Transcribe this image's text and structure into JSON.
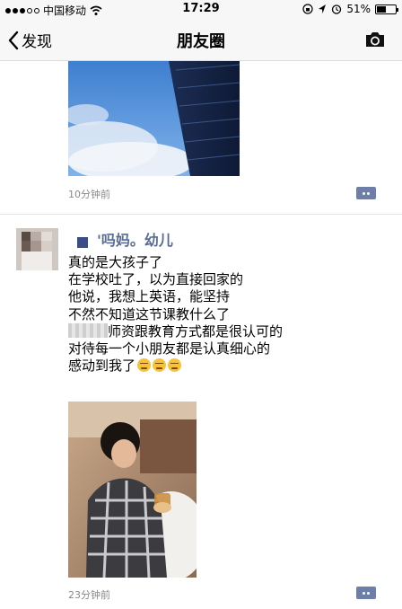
{
  "status_bar": {
    "carrier": "中国移动",
    "time": "17:29",
    "battery": "51%",
    "battery_level": 0.51
  },
  "nav": {
    "back_label": "发现",
    "title": "朋友圈"
  },
  "posts": [
    {
      "time_ago": "10分钟前"
    },
    {
      "author": "'吗妈。幼儿",
      "lines": [
        "真的是大孩子了",
        "在学校吐了，以为直接回家的",
        "他说，我想上英语，能坚持",
        "不然不知道这节课教什么了",
        "师资跟教育方式都是很认可的",
        "对待每一个小朋友都是认真细心的",
        "感动到我了"
      ],
      "time_ago": "23分钟前"
    }
  ],
  "icons": {
    "back": "chevron-left-icon",
    "camera": "camera-icon",
    "comment": "comment-icon",
    "wifi": "wifi-icon",
    "location": "location-arrow-icon",
    "alarm": "alarm-icon",
    "lock": "rotation-lock-icon"
  },
  "colors": {
    "author": "#576b95",
    "comment_button": "#6d7ea8",
    "time": "#888888"
  }
}
